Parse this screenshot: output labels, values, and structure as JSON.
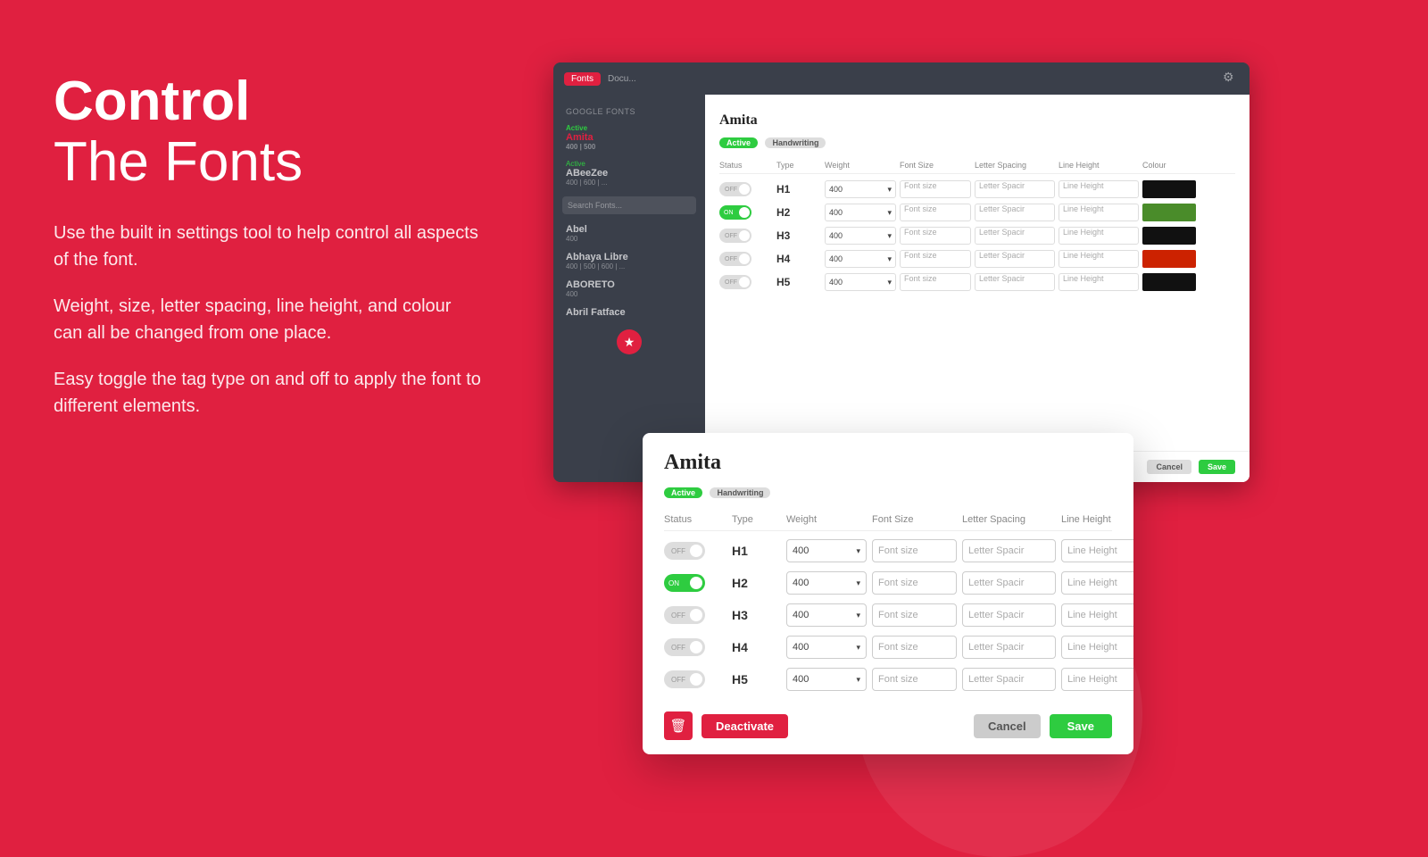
{
  "background_color": "#e02040",
  "left_panel": {
    "headline_bold": "Control",
    "headline_light": "The Fonts",
    "description_1": "Use the built in settings tool to help control all aspects of the font.",
    "description_2": "Weight, size, letter spacing, line height, and colour can all be changed from one place.",
    "description_3": "Easy toggle the tag type on and off to apply the font to different elements."
  },
  "app_window": {
    "tab_label": "Fonts",
    "tab_label2": "Docu...",
    "sidebar": {
      "section_label": "Google Fonts",
      "items": [
        {
          "name": "Amita",
          "meta": "400 | 500",
          "active": true
        },
        {
          "name": "ABeeZee",
          "meta": "400 | 600 | ...",
          "active": false
        },
        {
          "name": "Abel",
          "meta": "400",
          "active": false
        },
        {
          "name": "Abhaya Libre",
          "meta": "400 | 500 | 600 | ...",
          "active": false
        },
        {
          "name": "ABORETO",
          "meta": "400",
          "active": false
        },
        {
          "name": "Abril Fatface",
          "meta": "",
          "active": false
        }
      ],
      "search_placeholder": "Search Fonts..."
    }
  },
  "font_modal": {
    "font_name": "Amita",
    "tags": [
      {
        "label": "Active",
        "type": "active"
      },
      {
        "label": "Handwriting",
        "type": "handwriting"
      }
    ],
    "table_headers": [
      "Status",
      "Type",
      "Weight",
      "Font Size",
      "Letter Spacing",
      "Line Height",
      "Colour"
    ],
    "rows": [
      {
        "status": "OFF",
        "status_on": false,
        "type": "H1",
        "weight": "400",
        "font_size_placeholder": "Font size",
        "letter_spacing_placeholder": "Letter Spacir",
        "line_height_placeholder": "Line Height",
        "color": "#111111"
      },
      {
        "status": "ON",
        "status_on": true,
        "type": "H2",
        "weight": "400",
        "font_size_placeholder": "Font size",
        "letter_spacing_placeholder": "Letter Spacir",
        "line_height_placeholder": "Line Height",
        "color": "#4a8c2a"
      },
      {
        "status": "OFF",
        "status_on": false,
        "type": "H3",
        "weight": "400",
        "font_size_placeholder": "Font size",
        "letter_spacing_placeholder": "Letter Spacir",
        "line_height_placeholder": "Line Height",
        "color": "#111111"
      },
      {
        "status": "OFF",
        "status_on": false,
        "type": "H4",
        "weight": "400",
        "font_size_placeholder": "Font size",
        "letter_spacing_placeholder": "Letter Spacir",
        "line_height_placeholder": "Line Height",
        "color": "#cc2200"
      },
      {
        "status": "OFF",
        "status_on": false,
        "type": "H5",
        "weight": "400",
        "font_size_placeholder": "Font size",
        "letter_spacing_placeholder": "Letter Spacir",
        "line_height_placeholder": "Line Height",
        "color": "#111111"
      }
    ],
    "buttons": {
      "trash": "🗑",
      "deactivate": "Deactivate",
      "cancel": "Cancel",
      "save": "Save"
    }
  }
}
